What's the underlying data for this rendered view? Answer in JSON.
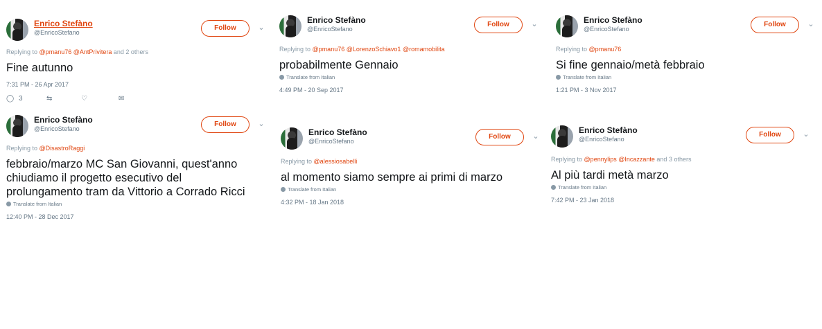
{
  "tweets": [
    {
      "name": "Enrico Stefàno",
      "handle": "@EnricoStefano",
      "follow_label": "Follow",
      "replying_prefix": "Replying to",
      "mentions": [
        "@pmanu76",
        "@AntPrivitera"
      ],
      "replying_suffix": "and 2 others",
      "text": "Fine autunno",
      "time": "7:31 PM - 26 Apr 2017",
      "reply_count": "3"
    },
    {
      "name": "Enrico Stefàno",
      "handle": "@EnricoStefano",
      "follow_label": "Follow",
      "replying_prefix": "Replying to",
      "mentions": [
        "@pmanu76",
        "@LorenzoSchiavo1",
        "@romamobilita"
      ],
      "text": "probabilmente Gennaio",
      "translate": "Translate from Italian",
      "time": "4:49 PM - 20 Sep 2017"
    },
    {
      "name": "Enrico Stefàno",
      "handle": "@EnricoStefano",
      "follow_label": "Follow",
      "replying_prefix": "Replying to",
      "mentions": [
        "@pmanu76"
      ],
      "text": "Si fine gennaio/metà febbraio",
      "translate": "Translate from Italian",
      "time": "1:21 PM - 3 Nov 2017"
    },
    {
      "name": "Enrico Stefàno",
      "handle": "@EnricoStefano",
      "follow_label": "Follow",
      "replying_prefix": "Replying to",
      "mentions": [
        "@DisastroRaggi"
      ],
      "text": "febbraio/marzo MC San Giovanni, quest'anno chiudiamo il progetto esecutivo del prolungamento tram da Vittorio a Corrado Ricci",
      "translate": "Translate from Italian",
      "time": "12:40 PM - 28 Dec 2017"
    },
    {
      "name": "Enrico Stefàno",
      "handle": "@EnricoStefano",
      "follow_label": "Follow",
      "replying_prefix": "Replying to",
      "mentions": [
        "@alessiosabelli"
      ],
      "text": "al momento siamo sempre ai primi di marzo",
      "translate": "Translate from Italian",
      "time": "4:32 PM - 18 Jan 2018"
    },
    {
      "name": "Enrico Stefàno",
      "handle": "@EnricoStefano",
      "follow_label": "Follow",
      "replying_prefix": "Replying to",
      "mentions": [
        "@pennylips",
        "@Incazzante"
      ],
      "replying_suffix": "and 3 others",
      "text": "Al più tardi metà marzo",
      "translate": "Translate from Italian",
      "time": "7:42 PM - 23 Jan 2018"
    }
  ],
  "colors": {
    "accent": "#e0450f",
    "muted": "#657786",
    "text": "#14171a"
  },
  "icons": {
    "reply": "reply-icon",
    "retweet": "retweet-icon",
    "like": "heart-icon",
    "dm": "envelope-icon",
    "translate": "globe-icon",
    "more": "chevron-down-icon"
  }
}
